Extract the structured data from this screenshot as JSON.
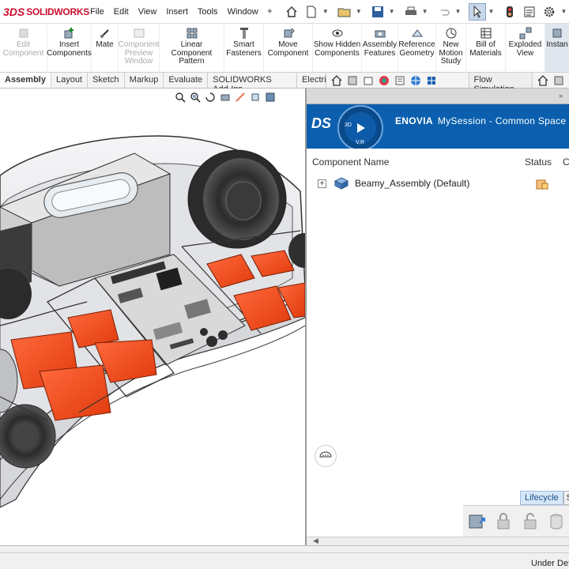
{
  "app": {
    "brand_ds": "3DS",
    "brand_name": "SOLIDWORKS"
  },
  "menu": [
    "File",
    "Edit",
    "View",
    "Insert",
    "Tools",
    "Window"
  ],
  "ribbon": [
    {
      "label": "Edit Component",
      "icon": "edit-component-icon",
      "disabled": true
    },
    {
      "label": "Insert Components",
      "icon": "insert-components-icon"
    },
    {
      "label": "Mate",
      "icon": "mate-icon"
    },
    {
      "label": "Component Preview Window",
      "icon": "preview-window-icon",
      "disabled": true
    },
    {
      "label": "Linear Component Pattern",
      "icon": "linear-pattern-icon"
    },
    {
      "label": "Smart Fasteners",
      "icon": "smart-fasteners-icon"
    },
    {
      "label": "Move Component",
      "icon": "move-component-icon"
    },
    {
      "label": "Show Hidden Components",
      "icon": "show-hidden-icon"
    },
    {
      "label": "Assembly Features",
      "icon": "assembly-features-icon"
    },
    {
      "label": "Reference Geometry",
      "icon": "reference-geometry-icon"
    },
    {
      "label": "New Motion Study",
      "icon": "motion-study-icon"
    },
    {
      "label": "Bill of Materials",
      "icon": "bill-of-materials-icon"
    },
    {
      "label": "Exploded View",
      "icon": "exploded-view-icon"
    },
    {
      "label": "Instan",
      "icon": "instant3d-icon",
      "active": true
    }
  ],
  "tabs": [
    "Assembly",
    "Layout",
    "Sketch",
    "Markup",
    "Evaluate",
    "SOLIDWORKS Add-Ins",
    "Electrics"
  ],
  "flow_tab": "Flow Simulation",
  "enovia": {
    "brand": "ENOVIA",
    "title": "MySession - Common Space (I",
    "compass_3d": "3D",
    "compass_vr": "V,R"
  },
  "table": {
    "headers": [
      "Component Name",
      "Status",
      "C"
    ],
    "rows": [
      {
        "name": "Beamy_Assembly (Default)"
      }
    ]
  },
  "bottom_tabs": [
    "Lifecycle",
    "S"
  ],
  "status": {
    "text": "Under Defin"
  },
  "colors": {
    "enovia_blue": "#0b5fae",
    "part_orange": "#ff4a14",
    "brand_red": "#c8102e"
  }
}
